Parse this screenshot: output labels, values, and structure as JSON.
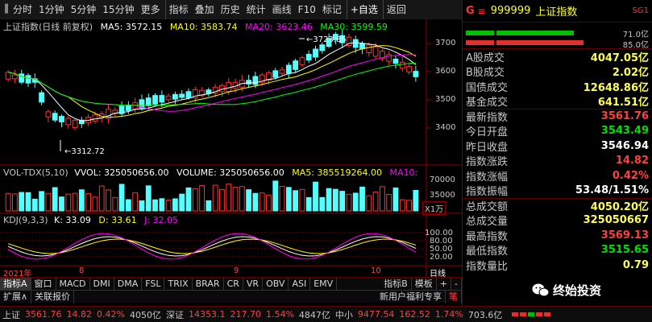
{
  "toolbar": {
    "items": [
      "分时",
      "1分钟",
      "5分钟",
      "15分钟",
      "更多",
      "指标",
      "叠加",
      "历史",
      "统计",
      "画线",
      "F10",
      "标记",
      "+自选",
      "返回"
    ]
  },
  "chart_header": {
    "title": "上证指数(日线 前复权)",
    "ma5": "MA5: 3572.15",
    "ma10": "MA10: 3583.74",
    "ma20": "MA20: 3623.46",
    "ma30": "MA30: 3599.59"
  },
  "price_axis": [
    "3700",
    "3600",
    "3500",
    "3400"
  ],
  "annotations": {
    "high": "3723.85",
    "low": "3312.72"
  },
  "volume_header": {
    "label": "VOL-TDX(5,10)",
    "vvol": "VVOL: 325050656.00",
    "volume": "VOLUME: 325050656.00",
    "ma5": "MA5: 385519264.00",
    "ma10": "MA10:"
  },
  "volume_axis": [
    "70000",
    "35000"
  ],
  "volume_unit": "X1万",
  "kdj_header": {
    "label": "KDJ(9,3,3)",
    "k": "K: 33.09",
    "d": "D: 33.61",
    "j": "J: 32.05"
  },
  "kdj_axis": [
    "100.00",
    "80.00",
    "50.00",
    "20.00"
  ],
  "date_axis": {
    "year": "2021年",
    "months": [
      "8",
      "9",
      "10"
    ],
    "period": "日线"
  },
  "indicator_tabs": [
    "指标A",
    "窗口",
    "MACD",
    "DMI",
    "DMA",
    "FSL",
    "TRIX",
    "BRAR",
    "CR",
    "VR",
    "OBV",
    "ASI",
    "EMV"
  ],
  "indicator_tabs_right": [
    "指标B",
    "模板",
    "+",
    "-"
  ],
  "bottom_tabs": [
    "扩展",
    "关联报价"
  ],
  "bottom_right_tabs": [
    "新用户福利专享",
    "笔"
  ],
  "right_panel": {
    "g_label": "G",
    "menu_icon": "≡",
    "code": "999999",
    "name": "上证指数",
    "tag": "SG1",
    "ratio1": "71.0亿",
    "ratio2": "85.0亿",
    "rows": [
      {
        "k": "A股成交",
        "v": "4047.05亿",
        "color": "yellow"
      },
      {
        "k": "B股成交",
        "v": "2.02亿",
        "color": "yellow"
      },
      {
        "k": "国债成交",
        "v": "12648.86亿",
        "color": "yellow"
      },
      {
        "k": "基金成交",
        "v": "641.51亿",
        "color": "yellow"
      },
      {
        "k": "最新指数",
        "v": "3561.76",
        "color": "red"
      },
      {
        "k": "今日开盘",
        "v": "3543.49",
        "color": "green"
      },
      {
        "k": "昨日收盘",
        "v": "3546.94",
        "color": "white"
      },
      {
        "k": "指数涨跌",
        "v": "14.82",
        "color": "red"
      },
      {
        "k": "指数涨幅",
        "v": "0.42%",
        "color": "red"
      },
      {
        "k": "指数振幅",
        "v": "53.48/1.51%",
        "color": "white"
      },
      {
        "k": "总成交额",
        "v": "4050.20亿",
        "color": "yellow"
      },
      {
        "k": "总成交量",
        "v": "325050667",
        "color": "yellow"
      },
      {
        "k": "最高指数",
        "v": "3569.13",
        "color": "red"
      },
      {
        "k": "最低指数",
        "v": "3515.65",
        "color": "green"
      },
      {
        "k": "指数量比",
        "v": "0.79",
        "color": "yellow"
      }
    ]
  },
  "status_bar": {
    "sh_name": "上证",
    "sh_price": "3561.76",
    "sh_chg": "14.82",
    "sh_pct": "0.42%",
    "sh_amt": "4050亿",
    "sz_name": "深证",
    "sz_price": "14353.1",
    "sz_chg": "217.70",
    "sz_pct": "1.54%",
    "sz_amt": "4847亿",
    "zx_name": "中小",
    "zx_price": "9477.54",
    "zx_chg": "162.52",
    "zx_pct": "1.74%",
    "zx_amt": "703.6亿"
  },
  "watermark": {
    "text": "终始投资"
  },
  "colors": {
    "up": "#ff3232",
    "down": "#54ffff",
    "ma5": "#ffffff",
    "ma10": "#ffff00",
    "ma20": "#ff00ff",
    "ma30": "#00ff00",
    "grid": "#8b0000"
  }
}
